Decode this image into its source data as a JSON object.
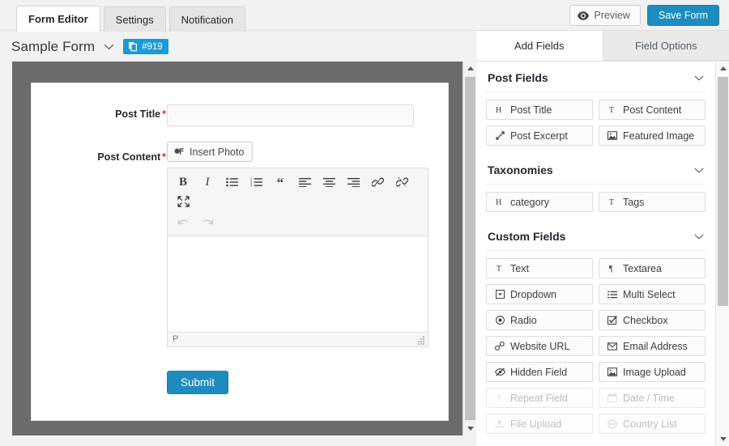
{
  "topbar": {
    "tabs": [
      {
        "label": "Form Editor",
        "active": true
      },
      {
        "label": "Settings",
        "active": false
      },
      {
        "label": "Notification",
        "active": false
      }
    ],
    "preview_label": "Preview",
    "save_label": "Save Form",
    "accent_blue": "#1e8cbe"
  },
  "form_header": {
    "name": "Sample Form",
    "id_badge": "#919",
    "badge_color": "#1a9bd7"
  },
  "canvas": {
    "fields": {
      "post_title": {
        "label": "Post Title",
        "required": "*",
        "value": "",
        "placeholder": ""
      },
      "post_content": {
        "label": "Post Content",
        "required": "*"
      }
    },
    "insert_photo_label": "Insert Photo",
    "editor": {
      "toolbar_row1": [
        {
          "name": "bold",
          "glyph": "B"
        },
        {
          "name": "italic",
          "glyph": "I"
        },
        {
          "name": "unordered-list",
          "glyph": ""
        },
        {
          "name": "ordered-list",
          "glyph": ""
        },
        {
          "name": "blockquote",
          "glyph": "“"
        },
        {
          "name": "align-left",
          "glyph": ""
        },
        {
          "name": "align-center",
          "glyph": ""
        },
        {
          "name": "align-right",
          "glyph": ""
        },
        {
          "name": "link",
          "glyph": ""
        },
        {
          "name": "unlink",
          "glyph": ""
        }
      ],
      "toolbar_row1b": [
        {
          "name": "fullscreen",
          "glyph": ""
        }
      ],
      "toolbar_row2": [
        {
          "name": "undo",
          "glyph": ""
        },
        {
          "name": "redo",
          "glyph": ""
        }
      ],
      "content": "",
      "status_path": "P"
    },
    "submit_label": "Submit"
  },
  "panel": {
    "tabs": [
      {
        "label": "Add Fields",
        "active": true
      },
      {
        "label": "Field Options",
        "active": false
      }
    ],
    "groups": [
      {
        "title": "Post Fields",
        "collapse_icon": "chevron-down-icon",
        "fields": [
          {
            "label": "Post Title",
            "icon": "heading-icon",
            "disabled": false
          },
          {
            "label": "Post Content",
            "icon": "text-cursor-icon",
            "disabled": false
          },
          {
            "label": "Post Excerpt",
            "icon": "excerpt-icon",
            "disabled": false
          },
          {
            "label": "Featured Image",
            "icon": "image-icon",
            "disabled": false
          }
        ]
      },
      {
        "title": "Taxonomies",
        "collapse_icon": "chevron-down-icon",
        "fields": [
          {
            "label": "category",
            "icon": "heading-icon",
            "disabled": false
          },
          {
            "label": "Tags",
            "icon": "text-cursor-icon",
            "disabled": false
          }
        ]
      },
      {
        "title": "Custom Fields",
        "collapse_icon": "chevron-down-icon",
        "fields": [
          {
            "label": "Text",
            "icon": "text-cursor-icon",
            "disabled": false
          },
          {
            "label": "Textarea",
            "icon": "paragraph-icon",
            "disabled": false
          },
          {
            "label": "Dropdown",
            "icon": "dropdown-icon",
            "disabled": false
          },
          {
            "label": "Multi Select",
            "icon": "list-icon",
            "disabled": false
          },
          {
            "label": "Radio",
            "icon": "radio-icon",
            "disabled": false
          },
          {
            "label": "Checkbox",
            "icon": "checkbox-icon",
            "disabled": false
          },
          {
            "label": "Website URL",
            "icon": "link-icon",
            "disabled": false
          },
          {
            "label": "Email Address",
            "icon": "envelope-icon",
            "disabled": false
          },
          {
            "label": "Hidden Field",
            "icon": "eye-slash-icon",
            "disabled": false
          },
          {
            "label": "Image Upload",
            "icon": "image-icon",
            "disabled": false
          },
          {
            "label": "Repeat Field",
            "icon": "text-cursor-icon",
            "disabled": true
          },
          {
            "label": "Date / Time",
            "icon": "calendar-icon",
            "disabled": true
          },
          {
            "label": "File Upload",
            "icon": "upload-icon",
            "disabled": true
          },
          {
            "label": "Country List",
            "icon": "globe-icon",
            "disabled": true
          }
        ]
      }
    ]
  }
}
